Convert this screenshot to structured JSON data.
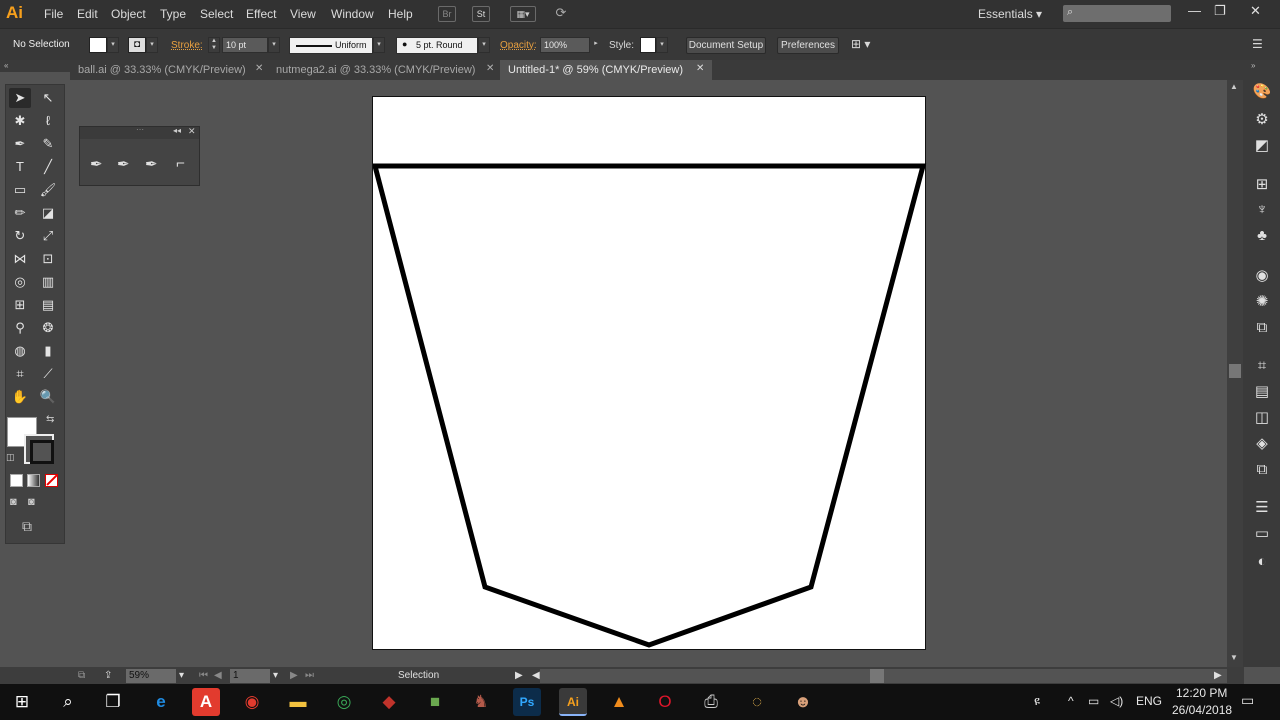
{
  "menubar": {
    "logo": "Ai",
    "items": [
      "File",
      "Edit",
      "Object",
      "Type",
      "Select",
      "Effect",
      "View",
      "Window",
      "Help"
    ],
    "bridge_icon": "Br",
    "stock_icon": "St",
    "workspace": "Essentials"
  },
  "controlbar": {
    "selection": "No Selection",
    "stroke_label": "Stroke:",
    "stroke_value": "10 pt",
    "profile": "Uniform",
    "brush": "5 pt. Round",
    "opacity_label": "Opacity:",
    "opacity_value": "100%",
    "style_label": "Style:",
    "document_setup": "Document Setup",
    "preferences": "Preferences"
  },
  "tabs": [
    {
      "label": "ball.ai @ 33.33% (CMYK/Preview)",
      "active": false
    },
    {
      "label": "nutmega2.ai @ 33.33% (CMYK/Preview)",
      "active": false
    },
    {
      "label": "Untitled-1* @ 59% (CMYK/Preview)",
      "active": true
    }
  ],
  "statusbar": {
    "zoom": "59%",
    "artboard": "1",
    "tool": "Selection"
  },
  "taskbar": {
    "lang": "ENG",
    "time": "12:20 PM",
    "date": "26/04/2018"
  },
  "colors": {
    "accent": "#f7a01c",
    "panel": "#535353",
    "dark": "#323232"
  }
}
